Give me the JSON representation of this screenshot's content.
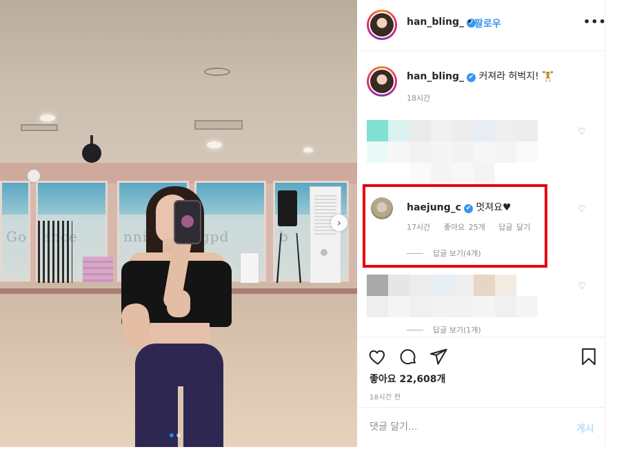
{
  "post": {
    "username": "han_bling_",
    "verified_mark": "✔",
    "separator": "•",
    "follow_label": "팔로우",
    "more_label": "•••",
    "caption": {
      "username": "han_bling_",
      "text": "커져라 허벅지! 🏋",
      "time": "18시간"
    },
    "highlighted_comment": {
      "username": "haejung_c",
      "text": "멋져요♥",
      "time": "17시간",
      "likes": "좋아요 25개",
      "reply_label": "답글 달기",
      "view_replies": "답글 보기(4개)"
    },
    "other_comment_replies": "답글 보기(1개)",
    "likes": "좋아요 22,608개",
    "posted": "18시간 전",
    "comment_placeholder": "댓글 달기...",
    "post_label": "게시",
    "carousel_next": "›",
    "heart_small": "♡",
    "icons": [
      "heart-icon",
      "comment-icon",
      "share-icon",
      "bookmark-icon"
    ]
  },
  "photo": {
    "window_words": [
      "Go",
      "ance",
      "nnib",
      "gpd",
      "b"
    ]
  },
  "colors": {
    "accent": "#3897f0",
    "highlight_box": "#e60012",
    "legging": "#2e2752"
  }
}
